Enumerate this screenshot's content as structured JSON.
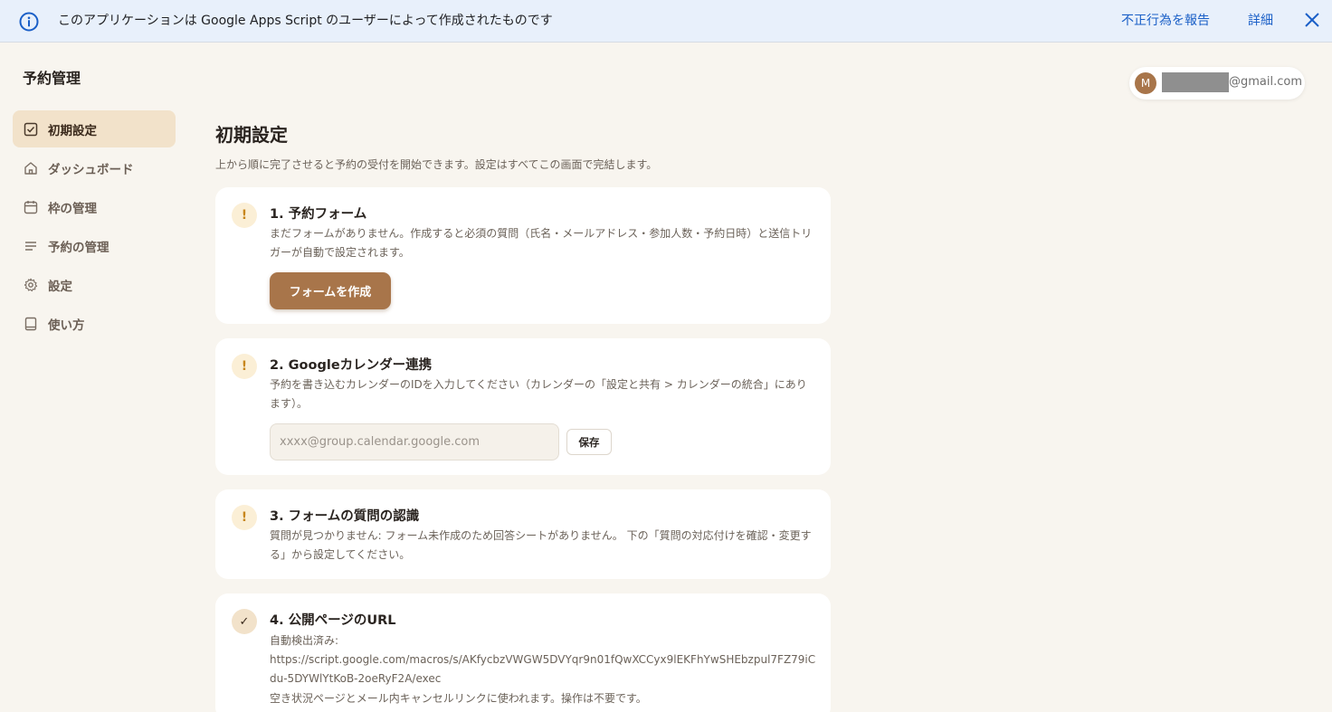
{
  "banner": {
    "message": "このアプリケーションは Google Apps Script のユーザーによって作成されたものです",
    "report_label": "不正行為を報告",
    "detail_label": "詳細"
  },
  "app": {
    "title": "予約管理"
  },
  "sidebar": {
    "items": [
      {
        "label": "初期設定",
        "icon": "checkbox-icon",
        "active": true
      },
      {
        "label": "ダッシュボード",
        "icon": "home-icon",
        "active": false
      },
      {
        "label": "枠の管理",
        "icon": "calendar-icon",
        "active": false
      },
      {
        "label": "予約の管理",
        "icon": "list-icon",
        "active": false
      },
      {
        "label": "設定",
        "icon": "gear-icon",
        "active": false
      },
      {
        "label": "使い方",
        "icon": "book-icon",
        "active": false
      }
    ]
  },
  "user": {
    "avatar_initial": "M",
    "email_visible": "@gmail.com"
  },
  "main": {
    "title": "初期設定",
    "description": "上から順に完了させると予約の受付を開始できます。設定はすべてこの画面で完結します。",
    "steps": [
      {
        "status": "!",
        "title": "1. 予約フォーム",
        "text": "まだフォームがありません。作成すると必須の質問（氏名・メールアドレス・参加人数・予約日時）と送信トリガーが自動で設定されます。",
        "button_label": "フォームを作成"
      },
      {
        "status": "!",
        "title": "2. Googleカレンダー連携",
        "text": "予約を書き込むカレンダーのIDを入力してください（カレンダーの「設定と共有 > カレンダーの統合」にあります）。",
        "input_placeholder": "xxxx@group.calendar.google.com",
        "save_label": "保存"
      },
      {
        "status": "!",
        "title": "3. フォームの質問の認識",
        "text": "質問が見つかりません: フォーム未作成のため回答シートがありません。 下の「質問の対応付けを確認・変更する」から設定してください。"
      },
      {
        "status": "✓",
        "title": "4. 公開ページのURL",
        "url_label": "自動検出済み:",
        "url": "https://script.google.com/macros/s/AKfycbzVWGW5DVYqr9n01fQwXCCyx9lEKFhYwSHEbzpul7FZ79iCdu-5DYWlYtKoB-2oeRyF2A/exec",
        "note": "空き状況ページとメール内キャンセルリンクに使われます。操作は不要です。"
      }
    ]
  },
  "colors": {
    "accent": "#a8754a",
    "active_bg": "#f2e2ca",
    "warning": "#c7861c",
    "link": "#1a5fc7",
    "page_bg": "#f8f5ef"
  }
}
